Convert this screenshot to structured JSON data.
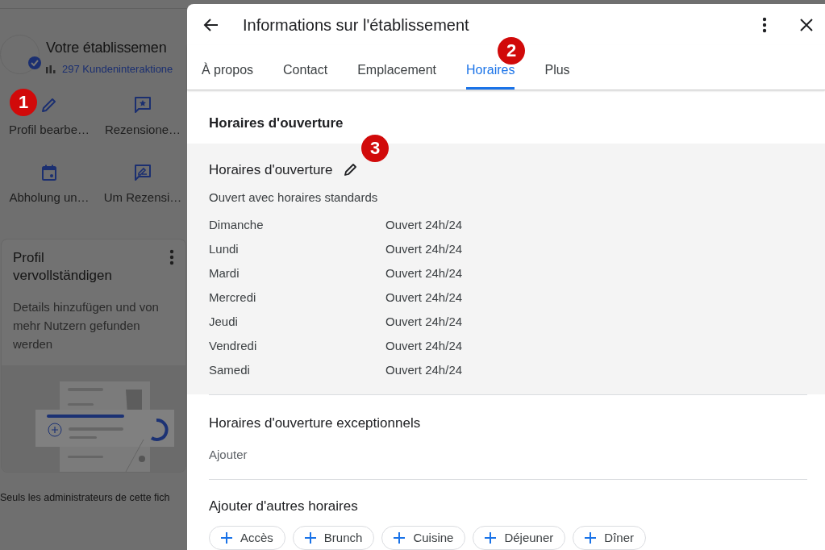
{
  "background": {
    "business_name": "Votre établissemen",
    "interactions": "297 Kundeninteraktione",
    "actions": [
      {
        "kind": "edit",
        "label": "Profil bearbe…"
      },
      {
        "kind": "reviews",
        "label": "Rezensione…"
      },
      {
        "kind": "calendar",
        "label": "Abholung un…"
      },
      {
        "kind": "ask_review",
        "label": "Um Rezensi…"
      }
    ],
    "card": {
      "title": "Profil vervollständigen",
      "description": "Details hinzufügen und von mehr Nutzern gefunden werden"
    },
    "footer": "Seuls les administrateurs de cette fich"
  },
  "dialog": {
    "title": "Informations sur l'établissement",
    "tabs": [
      {
        "label": "À propos",
        "selected": false
      },
      {
        "label": "Contact",
        "selected": false
      },
      {
        "label": "Emplacement",
        "selected": false
      },
      {
        "label": "Horaires",
        "selected": true
      },
      {
        "label": "Plus",
        "selected": false
      }
    ],
    "section_title": "Horaires d'ouverture",
    "hours": {
      "title": "Horaires d'ouverture",
      "status": "Ouvert avec horaires standards",
      "days": [
        {
          "day": "Dimanche",
          "hours": "Ouvert 24h/24"
        },
        {
          "day": "Lundi",
          "hours": "Ouvert 24h/24"
        },
        {
          "day": "Mardi",
          "hours": "Ouvert 24h/24"
        },
        {
          "day": "Mercredi",
          "hours": "Ouvert 24h/24"
        },
        {
          "day": "Jeudi",
          "hours": "Ouvert 24h/24"
        },
        {
          "day": "Vendredi",
          "hours": "Ouvert 24h/24"
        },
        {
          "day": "Samedi",
          "hours": "Ouvert 24h/24"
        }
      ]
    },
    "exceptional": {
      "title": "Horaires d'ouverture exceptionnels",
      "action": "Ajouter"
    },
    "other": {
      "title": "Ajouter d'autres horaires",
      "chips": [
        "Accès",
        "Brunch",
        "Cuisine",
        "Déjeuner",
        "Dîner"
      ]
    }
  },
  "annotations": [
    "1",
    "2",
    "3"
  ]
}
